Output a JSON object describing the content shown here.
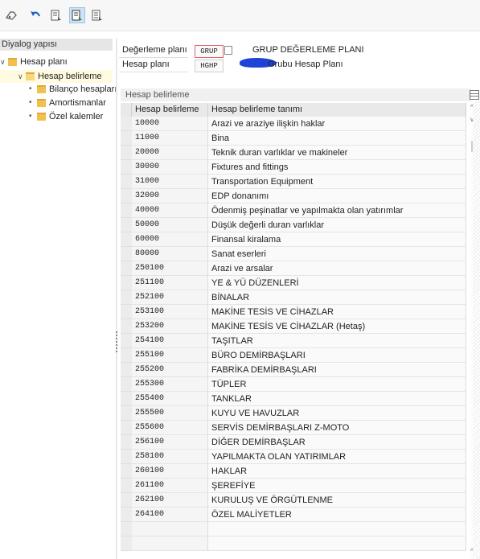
{
  "toolbar": {
    "buttons": [
      {
        "name": "other-object-icon"
      },
      {
        "name": "undo-icon"
      },
      {
        "name": "detail-icon"
      },
      {
        "name": "table-view-icon"
      },
      {
        "name": "select-all-icon"
      }
    ]
  },
  "tree": {
    "title": "Diyalog yapısı",
    "items": [
      {
        "label": "Hesap planı",
        "level": 0,
        "expanded": true
      },
      {
        "label": "Hesap belirleme",
        "level": 1,
        "expanded": true,
        "selected": true
      },
      {
        "label": "Bilanço hesapları",
        "level": 2
      },
      {
        "label": "Amortismanlar",
        "level": 2
      },
      {
        "label": "Özel kalemler",
        "level": 2
      }
    ]
  },
  "header": {
    "valuation_plan_label": "Değerleme planı",
    "valuation_plan_value": "GRUP",
    "valuation_plan_desc": "GRUP DEĞERLEME PLANI",
    "account_plan_label": "Hesap planı",
    "account_plan_value": "HGHP",
    "account_plan_desc": "Grubu Hesap Planı"
  },
  "panel": {
    "title": "Hesap belirleme",
    "columns": [
      "Hesap belirleme",
      "Hesap belirleme tanımı"
    ],
    "rows": [
      [
        "10000",
        "Arazi ve araziye ilişkin haklar"
      ],
      [
        "11000",
        "Bina"
      ],
      [
        "20000",
        "Teknik duran varlıklar ve makineler"
      ],
      [
        "30000",
        "Fixtures and fittings"
      ],
      [
        "31000",
        "Transportation Equipment"
      ],
      [
        "32000",
        "EDP donanımı"
      ],
      [
        "40000",
        "Ödenmiş peşinatlar ve yapılmakta olan yatırımlar"
      ],
      [
        "50000",
        "Düşük değerli duran varlıklar"
      ],
      [
        "60000",
        "Finansal kiralama"
      ],
      [
        "80000",
        "Sanat eserleri"
      ],
      [
        "250100",
        "Arazi ve arsalar"
      ],
      [
        "251100",
        "YE & YÜ DÜZENLERİ"
      ],
      [
        "252100",
        "BİNALAR"
      ],
      [
        "253100",
        "MAKİNE TESİS VE CİHAZLAR"
      ],
      [
        "253200",
        "MAKİNE TESİS VE CİHAZLAR (Hetaş)"
      ],
      [
        "254100",
        "TAŞITLAR"
      ],
      [
        "255100",
        "BÜRO DEMİRBAŞLARI"
      ],
      [
        "255200",
        "FABRİKA DEMİRBAŞLARI"
      ],
      [
        "255300",
        "TÜPLER"
      ],
      [
        "255400",
        "TANKLAR"
      ],
      [
        "255500",
        "KUYU VE HAVUZLAR"
      ],
      [
        "255600",
        "SERVİS DEMİRBAŞLARI Z-MOTO"
      ],
      [
        "256100",
        "DİĞER DEMİRBAŞLAR"
      ],
      [
        "258100",
        "YAPILMAKTA OLAN YATIRIMLAR"
      ],
      [
        "260100",
        "HAKLAR"
      ],
      [
        "261100",
        "ŞEREFİYE"
      ],
      [
        "262100",
        "KURULUŞ VE ÖRGÜTLENME"
      ],
      [
        "264100",
        "ÖZEL MALİYETLER"
      ],
      [
        "",
        ""
      ],
      [
        "",
        ""
      ]
    ]
  }
}
